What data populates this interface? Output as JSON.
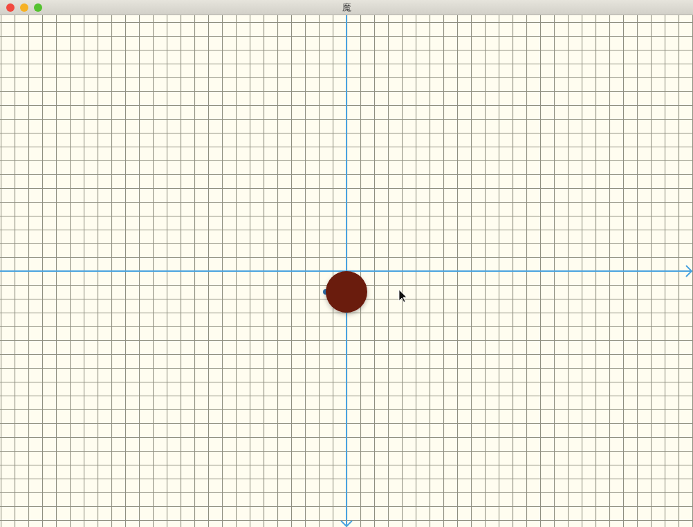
{
  "window": {
    "title": "魔"
  }
}
